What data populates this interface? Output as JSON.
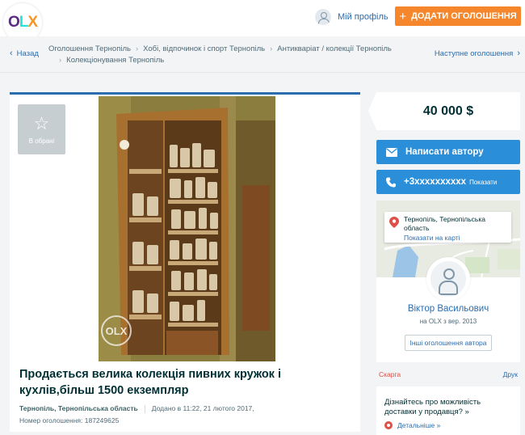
{
  "header": {
    "logo": {
      "o": "O",
      "l": "L",
      "x": "X"
    },
    "profile_label": "Мій профіль",
    "add_button_plus": "+",
    "add_button_label": "ДОДАТИ ОГОЛОШЕННЯ"
  },
  "nav": {
    "back_label": "Назад",
    "next_label": "Наступне оголошення",
    "breadcrumbs": [
      "Оголошення Тернопіль",
      "Хобі, відпочинок і спорт Тернопіль",
      "Антикваріат / колекції Тернопіль",
      "Колекціонування Тернопіль"
    ]
  },
  "listing": {
    "favorite_label": "В обрані",
    "watermark": "OLX",
    "title": "Продається велика колекція пивних кружок і кухлів,більш 1500 екземпляр",
    "location": "Тернопіль, Тернопільська область",
    "added": "Додано в 11:22, 21 лютого 2017,",
    "ad_number": "Номер оголошення: 187249625"
  },
  "sidebar": {
    "price": "40 000 $",
    "write_label": "Написати автору",
    "phone_label": "+3xxxxxxxxxx",
    "phone_show": "Показати",
    "map_location": "Тернопіль, Тернопільська область",
    "map_link": "Показати на карті",
    "seller_name": "Віктор Васильович",
    "seller_since": "на OLX з вер. 2013",
    "other_ads_label": "Інші оголошення автора",
    "complain_label": "Скарга",
    "print_label": "Друк",
    "delivery_text": "Дізнайтесь про можливість доставки у продавця? »",
    "delivery_link": "Детальніше »"
  },
  "colors": {
    "accent_orange": "#f5862b",
    "link_blue": "#2b6daf",
    "button_blue": "#2b8ed8",
    "text_dark": "#002f34",
    "complain_red": "#e04e45"
  }
}
